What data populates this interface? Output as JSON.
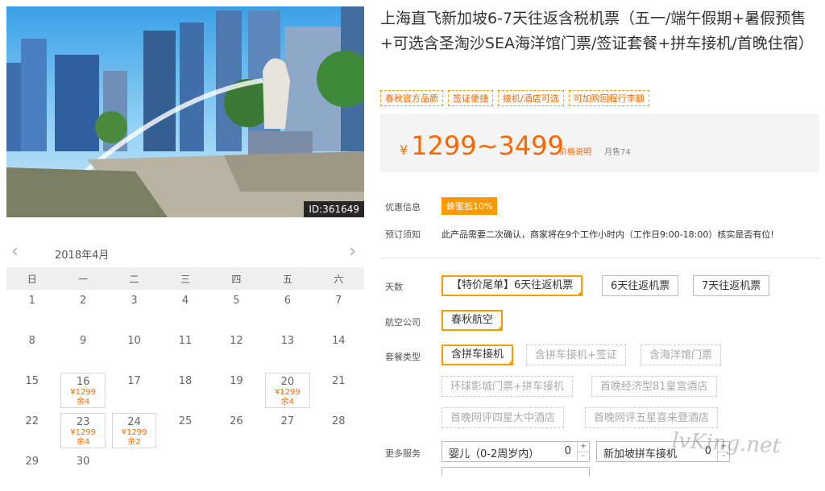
{
  "product": {
    "id_label": "ID:361649",
    "title": "上海直飞新加坡6-7天往返含税机票（五一/端午假期+暑假预售+可选含圣淘沙SEA海洋馆门票/签证套餐+拼车接机/首晚住宿）",
    "tags": [
      "春秋官方品质",
      "签证便捷",
      "接机/酒店可选",
      "可加购回程行李额"
    ],
    "currency": "¥",
    "price_range": "1299~3499",
    "price_note": "价格说明",
    "sales": "月售74",
    "promo_label": "优惠信息",
    "promo_badge": "蜂蜜抵10%",
    "notice_label": "预订须知",
    "notice_text": "此产品需要二次确认，商家将在9个工作小时内（工作日9:00-18:00）核实是否有位!"
  },
  "calendar": {
    "title": "2018年4月",
    "weekdays": [
      "日",
      "一",
      "二",
      "三",
      "四",
      "五",
      "六"
    ],
    "days": [
      {
        "d": "1"
      },
      {
        "d": "2"
      },
      {
        "d": "3"
      },
      {
        "d": "4"
      },
      {
        "d": "5"
      },
      {
        "d": "6"
      },
      {
        "d": "7"
      },
      {
        "d": "8"
      },
      {
        "d": "9"
      },
      {
        "d": "10"
      },
      {
        "d": "11"
      },
      {
        "d": "12"
      },
      {
        "d": "13"
      },
      {
        "d": "14"
      },
      {
        "d": "15"
      },
      {
        "d": "16",
        "price": "¥1299",
        "stock": "余4"
      },
      {
        "d": "17"
      },
      {
        "d": "18"
      },
      {
        "d": "19"
      },
      {
        "d": "20",
        "price": "¥1299",
        "stock": "余4"
      },
      {
        "d": "21"
      },
      {
        "d": "22"
      },
      {
        "d": "23",
        "price": "¥1299",
        "stock": "余4"
      },
      {
        "d": "24",
        "price": "¥1299",
        "stock": "余2"
      },
      {
        "d": "25"
      },
      {
        "d": "26"
      },
      {
        "d": "27"
      },
      {
        "d": "28"
      },
      {
        "d": "29"
      },
      {
        "d": "30"
      }
    ]
  },
  "options": {
    "days_label": "天数",
    "days": [
      "【特价尾单】6天往返机票",
      "6天往返机票",
      "7天往返机票"
    ],
    "airline_label": "航空公司",
    "airline": "春秋航空",
    "package_label": "套餐类型",
    "packages": [
      "含拼车接机",
      "含拼车接机+签证",
      "含海洋馆门票",
      "环球影城门票+拼车接机",
      "首晚经济型81皇宫酒店",
      "首晚网评四星大中酒店",
      "首晚网评五星喜来登酒店"
    ],
    "more_label": "更多服务",
    "services": [
      {
        "name": "婴儿（0-2周岁内）",
        "value": "0"
      },
      {
        "name": "新加坡拼车接机",
        "value": "0"
      }
    ],
    "plus": "+",
    "minus": "-"
  },
  "watermark": "lvKing.net"
}
